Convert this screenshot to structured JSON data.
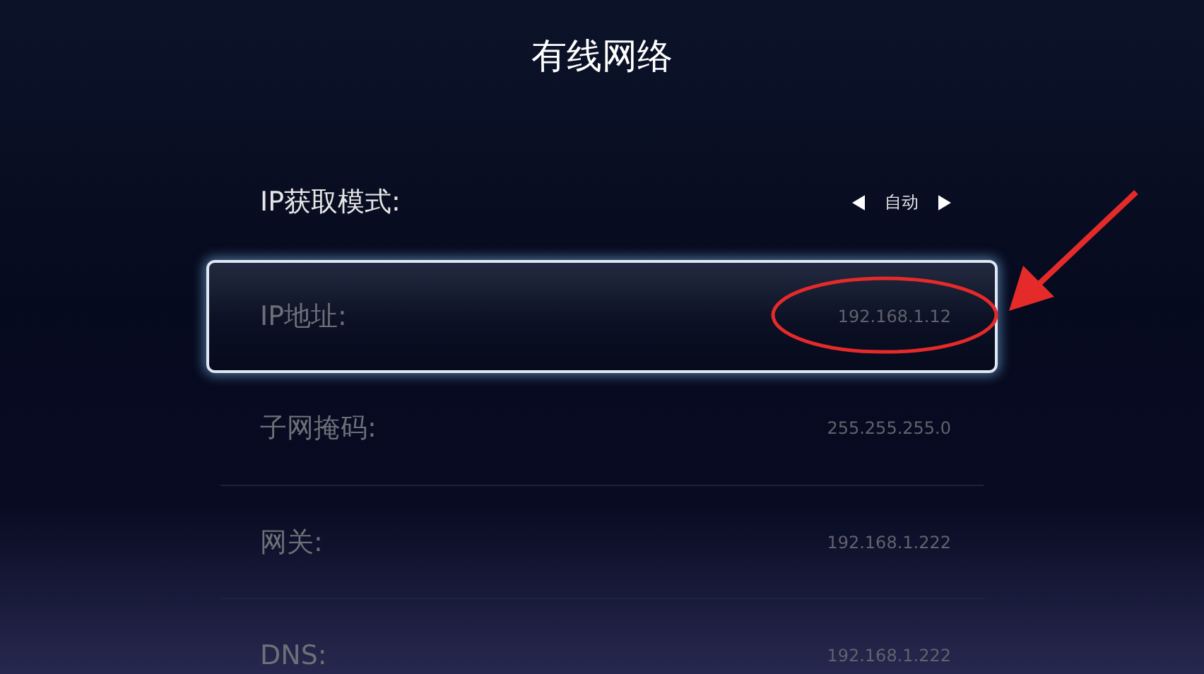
{
  "window": {
    "title": "有线网络"
  },
  "settings": [
    {
      "kind": "selector",
      "label": "IP获取模式:",
      "value": "自动",
      "selected": false,
      "disabled": false
    },
    {
      "kind": "value",
      "label": "IP地址:",
      "value": "192.168.1.12",
      "selected": true,
      "disabled": true
    },
    {
      "kind": "value",
      "label": "子网掩码:",
      "value": "255.255.255.0",
      "selected": false,
      "disabled": true
    },
    {
      "kind": "value",
      "label": "网关:",
      "value": "192.168.1.222",
      "selected": false,
      "disabled": true
    },
    {
      "kind": "value",
      "label": "DNS:",
      "value": "192.168.1.222",
      "selected": false,
      "disabled": true
    }
  ]
}
